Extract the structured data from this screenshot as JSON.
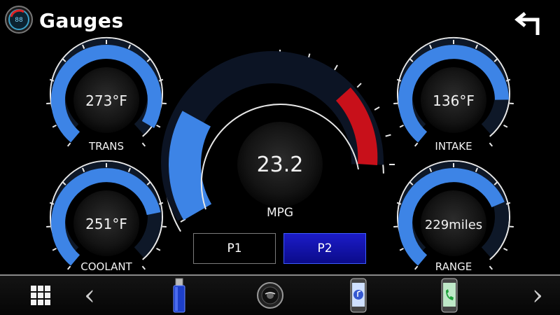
{
  "header": {
    "title": "Gauges"
  },
  "gauges": {
    "trans": {
      "value": "273°F",
      "label": "TRANS",
      "fill_fraction": 0.93
    },
    "coolant": {
      "value": "251°F",
      "label": "COOLANT",
      "fill_fraction": 0.78
    },
    "intake": {
      "value": "136°F",
      "label": "INTAKE",
      "fill_fraction": 0.82
    },
    "range": {
      "value": "229miles",
      "label": "RANGE",
      "fill_fraction": 0.74
    },
    "mpg": {
      "value": "23.2",
      "label": "MPG",
      "fill_fraction": 0.28
    }
  },
  "pages": {
    "p1": "P1",
    "p2": "P2",
    "active": "P2"
  },
  "dock": {
    "left_arrow": "‹",
    "right_arrow": "›",
    "items": [
      "apps-grid-icon",
      "usb-drive-icon",
      "disc-icon",
      "mobile-media-icon",
      "phone-call-icon"
    ]
  },
  "colors": {
    "accent_blue": "#3d84e6",
    "warning_red": "#c8101a",
    "active_button": "#1414b4"
  }
}
